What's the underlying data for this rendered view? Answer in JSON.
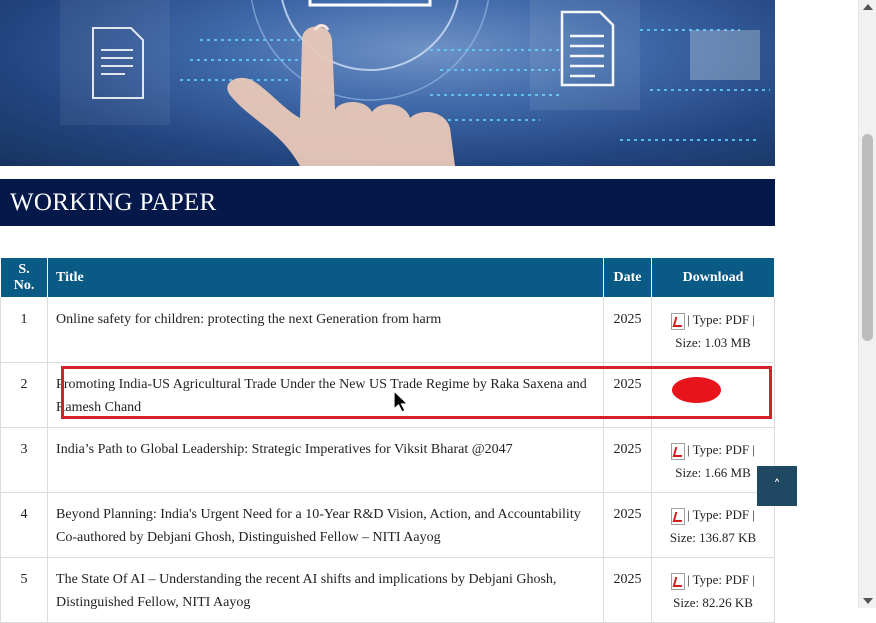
{
  "section": {
    "title": "WORKING PAPER"
  },
  "table": {
    "headers": {
      "sno": "S. No.",
      "title": "Title",
      "date": "Date",
      "download": "Download"
    },
    "rows": [
      {
        "sno": "1",
        "title": "Online safety for children: protecting the next Generation from harm",
        "date": "2025",
        "download": "| Type: PDF | Size: 1.03 MB"
      },
      {
        "sno": "2",
        "title": "Promoting India-US Agricultural Trade Under the New US Trade Regime by Raka Saxena and Ramesh Chand",
        "date": "2025",
        "download": ""
      },
      {
        "sno": "3",
        "title": "India’s Path to Global Leadership: Strategic Imperatives for Viksit Bharat @2047",
        "date": "2025",
        "download": "| Type: PDF | Size: 1.66 MB"
      },
      {
        "sno": "4",
        "title": "Beyond Planning: India's Urgent Need for a 10-Year R&D Vision, Action, and Accountability Co-authored by Debjani Ghosh, Distinguished Fellow – NITI Aayog",
        "date": "2025",
        "download": "| Type: PDF | Size: 136.87 KB"
      },
      {
        "sno": "5",
        "title": "The State Of AI – Understanding the recent AI shifts and implications by Debjani Ghosh, Distinguished Fellow, NITI Aayog",
        "date": "2025",
        "download": "| Type: PDF | Size: 82.26 KB"
      }
    ]
  },
  "back_to_top": {
    "icon": "chevron-up-icon",
    "glyph": "˄"
  },
  "colors": {
    "section_bg": "#05184a",
    "table_header_bg": "#0a5a86",
    "highlight": "#d5222a",
    "back_to_top_bg": "#1f4863"
  }
}
